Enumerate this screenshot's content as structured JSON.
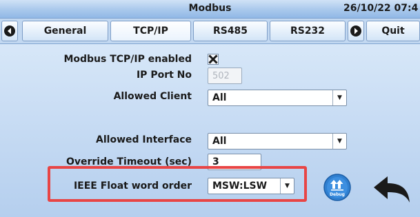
{
  "header": {
    "title": "Modbus",
    "datetime": "26/10/22 07:4"
  },
  "tabs": {
    "items": [
      {
        "label": "General"
      },
      {
        "label": "TCP/IP",
        "active": true
      },
      {
        "label": "RS485"
      },
      {
        "label": "RS232"
      }
    ],
    "quit_label": "Quit"
  },
  "form": {
    "tcp_enabled": {
      "label": "Modbus TCP/IP enabled",
      "checked": true
    },
    "ip_port": {
      "label": "IP Port No",
      "value": "502"
    },
    "allowed_client": {
      "label": "Allowed Client",
      "value": "All"
    },
    "allowed_interface": {
      "label": "Allowed Interface",
      "value": "All"
    },
    "override_timeout": {
      "label": "Override Timeout (sec)",
      "value": "3"
    },
    "float_word_order": {
      "label": "IEEE Float word order",
      "value": "MSW:LSW"
    }
  },
  "debug_button": {
    "label": "Debug"
  },
  "icons": {
    "prev": "circle-left-arrow-icon",
    "next": "circle-right-arrow-icon",
    "debug": "upload-arrows-icon",
    "back": "back-arrow-icon"
  },
  "colors": {
    "highlight": "#e84545",
    "panel": "#c2d8f2",
    "debug_button": "#2f7fd0"
  }
}
